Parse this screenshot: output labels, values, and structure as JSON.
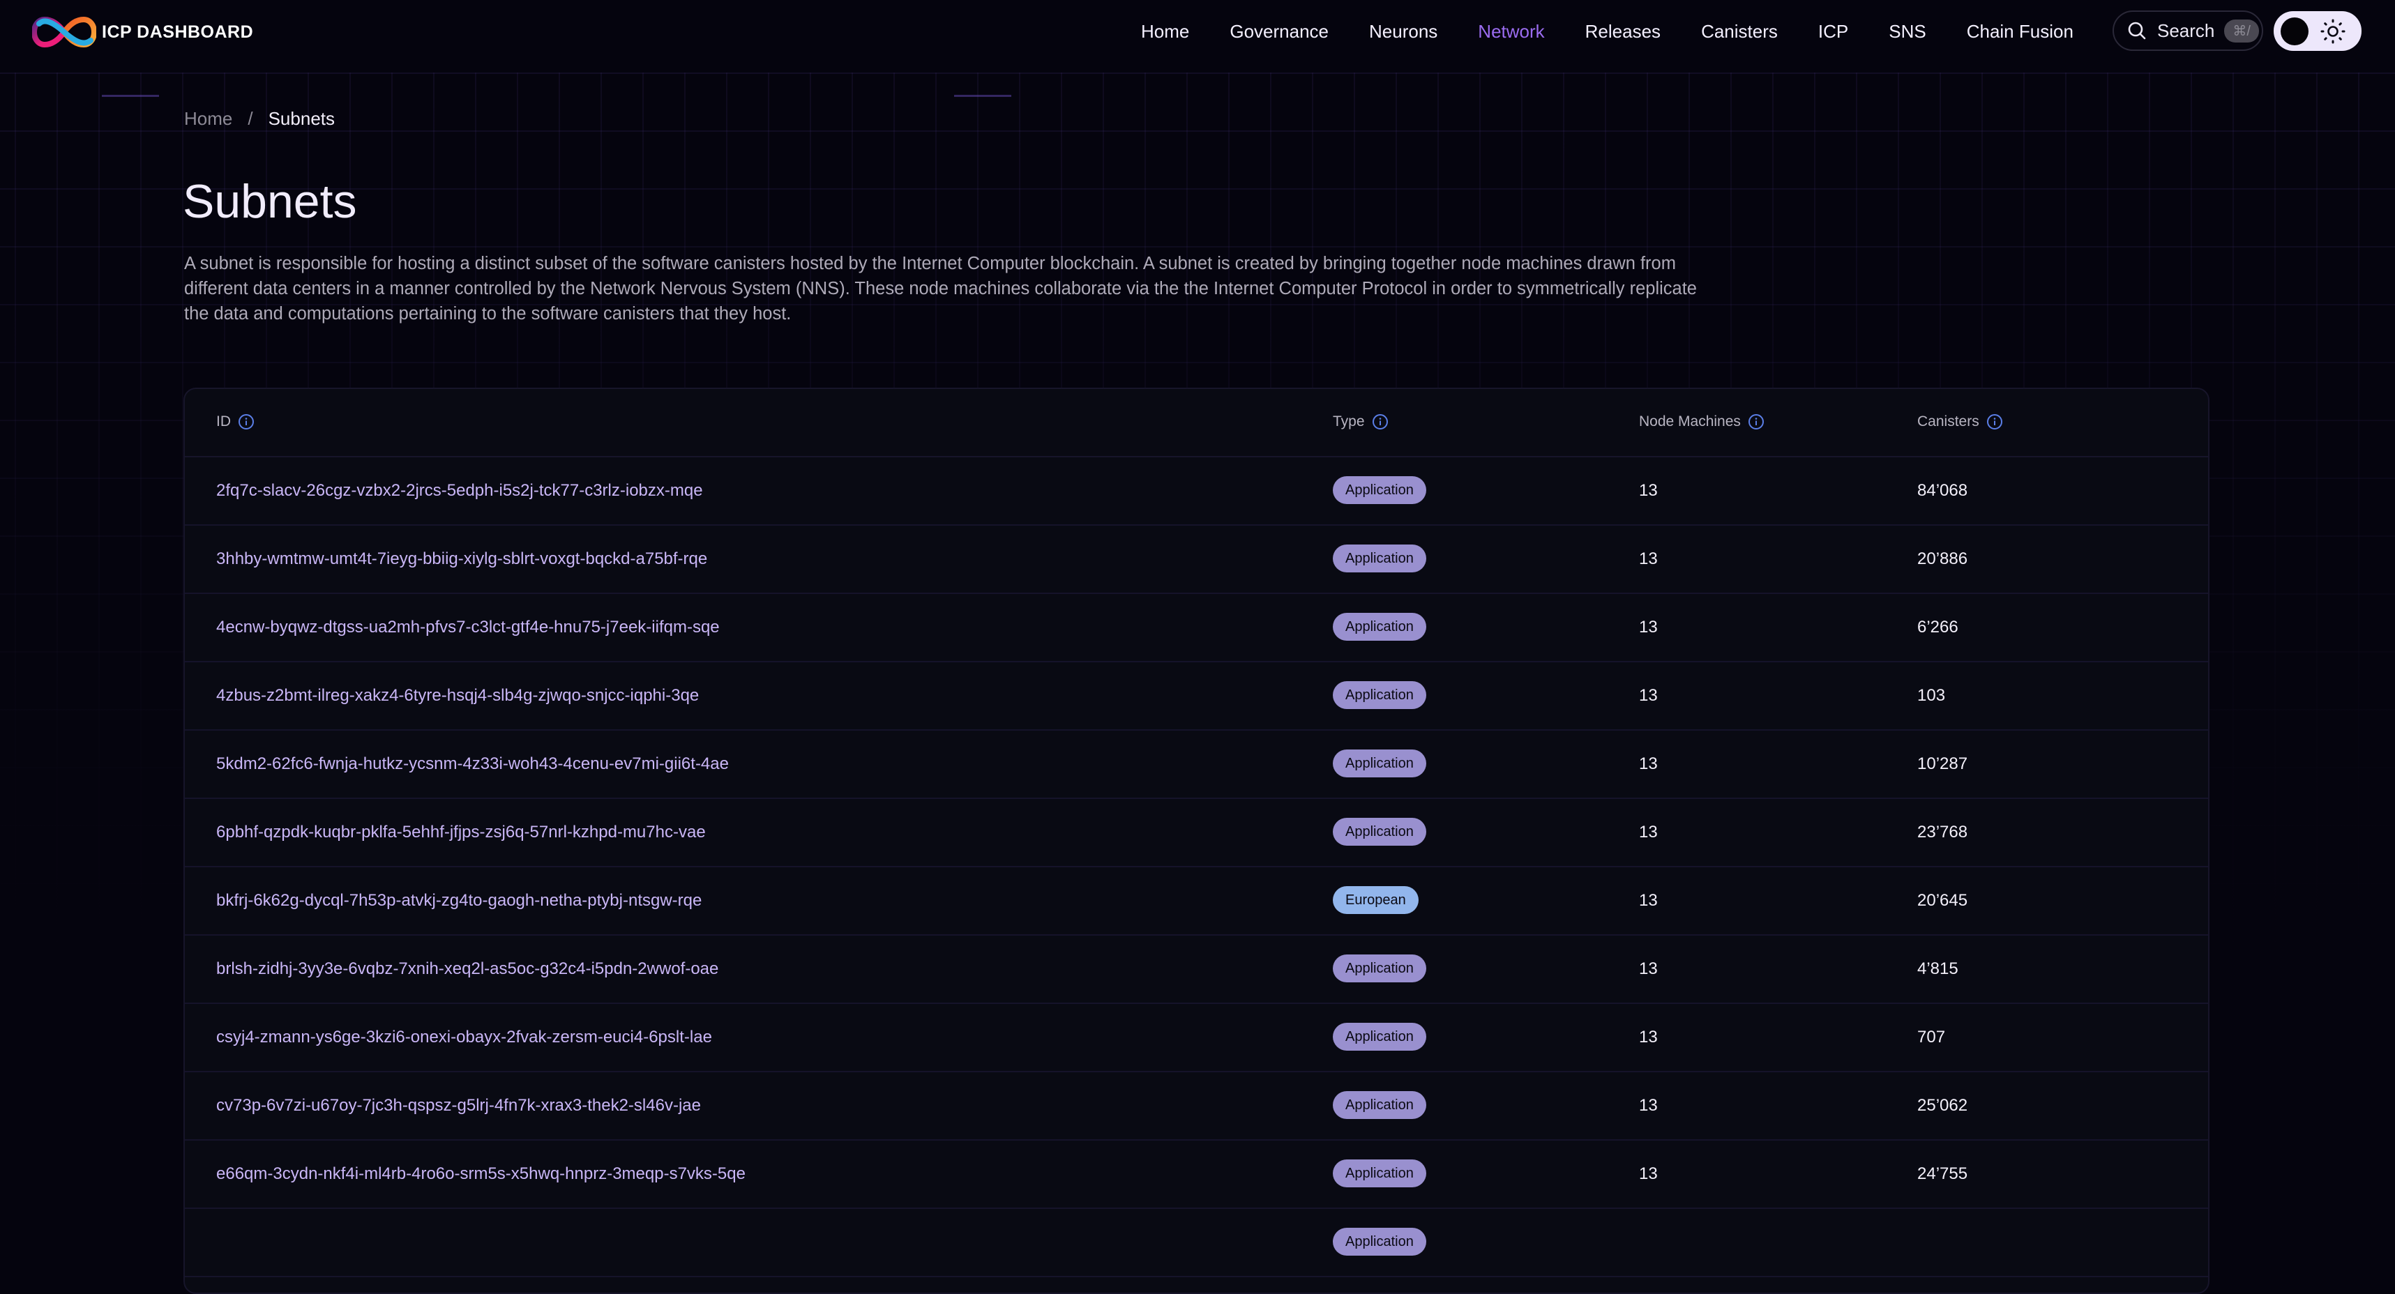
{
  "header": {
    "logo_text": "ICP DASHBOARD",
    "nav": [
      {
        "label": "Home",
        "active": false
      },
      {
        "label": "Governance",
        "active": false
      },
      {
        "label": "Neurons",
        "active": false
      },
      {
        "label": "Network",
        "active": true
      },
      {
        "label": "Releases",
        "active": false
      },
      {
        "label": "Canisters",
        "active": false
      },
      {
        "label": "ICP",
        "active": false
      },
      {
        "label": "SNS",
        "active": false
      },
      {
        "label": "Chain Fusion",
        "active": false
      }
    ],
    "search": {
      "label": "Search",
      "shortcut": "⌘/",
      "icon": "search-icon"
    },
    "theme_toggle": {
      "mode": "dark",
      "icon": "sun-icon"
    },
    "accent_color": "#9b6cf0"
  },
  "breadcrumb": {
    "home": "Home",
    "separator": "/",
    "current": "Subnets"
  },
  "page": {
    "title": "Subnets",
    "description": "A subnet is responsible for hosting a distinct subset of the software canisters hosted by the Internet Computer blockchain. A subnet is created by bringing together node machines drawn from different data centers in a manner controlled by the Network Nervous System (NNS). These node machines collaborate via the the Internet Computer Protocol in order to symmetrically replicate the data and computations pertaining to the software canisters that they host."
  },
  "table": {
    "columns": [
      {
        "label": "ID",
        "icon": "info-icon"
      },
      {
        "label": "Type",
        "icon": "info-icon"
      },
      {
        "label": "Node Machines",
        "icon": "info-icon"
      },
      {
        "label": "Canisters",
        "icon": "info-icon"
      }
    ],
    "badge_colors": {
      "Application": "#9990cf",
      "European": "#92b6ec"
    },
    "rows": [
      {
        "id": "2fq7c-slacv-26cgz-vzbx2-2jrcs-5edph-i5s2j-tck77-c3rlz-iobzx-mqe",
        "type": "Application",
        "nodes": "13",
        "canisters": "84’068"
      },
      {
        "id": "3hhby-wmtmw-umt4t-7ieyg-bbiig-xiylg-sblrt-voxgt-bqckd-a75bf-rqe",
        "type": "Application",
        "nodes": "13",
        "canisters": "20’886"
      },
      {
        "id": "4ecnw-byqwz-dtgss-ua2mh-pfvs7-c3lct-gtf4e-hnu75-j7eek-iifqm-sqe",
        "type": "Application",
        "nodes": "13",
        "canisters": "6’266"
      },
      {
        "id": "4zbus-z2bmt-ilreg-xakz4-6tyre-hsqj4-slb4g-zjwqo-snjcc-iqphi-3qe",
        "type": "Application",
        "nodes": "13",
        "canisters": "103"
      },
      {
        "id": "5kdm2-62fc6-fwnja-hutkz-ycsnm-4z33i-woh43-4cenu-ev7mi-gii6t-4ae",
        "type": "Application",
        "nodes": "13",
        "canisters": "10’287"
      },
      {
        "id": "6pbhf-qzpdk-kuqbr-pklfa-5ehhf-jfjps-zsj6q-57nrl-kzhpd-mu7hc-vae",
        "type": "Application",
        "nodes": "13",
        "canisters": "23’768"
      },
      {
        "id": "bkfrj-6k62g-dycql-7h53p-atvkj-zg4to-gaogh-netha-ptybj-ntsgw-rqe",
        "type": "European",
        "nodes": "13",
        "canisters": "20’645"
      },
      {
        "id": "brlsh-zidhj-3yy3e-6vqbz-7xnih-xeq2l-as5oc-g32c4-i5pdn-2wwof-oae",
        "type": "Application",
        "nodes": "13",
        "canisters": "4’815"
      },
      {
        "id": "csyj4-zmann-ys6ge-3kzi6-onexi-obayx-2fvak-zersm-euci4-6pslt-lae",
        "type": "Application",
        "nodes": "13",
        "canisters": "707"
      },
      {
        "id": "cv73p-6v7zi-u67oy-7jc3h-qspsz-g5lrj-4fn7k-xrax3-thek2-sl46v-jae",
        "type": "Application",
        "nodes": "13",
        "canisters": "25’062"
      },
      {
        "id": "e66qm-3cydn-nkf4i-ml4rb-4ro6o-srm5s-x5hwq-hnprz-3meqp-s7vks-5qe",
        "type": "Application",
        "nodes": "13",
        "canisters": "24’755"
      },
      {
        "id": "",
        "type": "Application",
        "nodes": "",
        "canisters": ""
      }
    ]
  }
}
